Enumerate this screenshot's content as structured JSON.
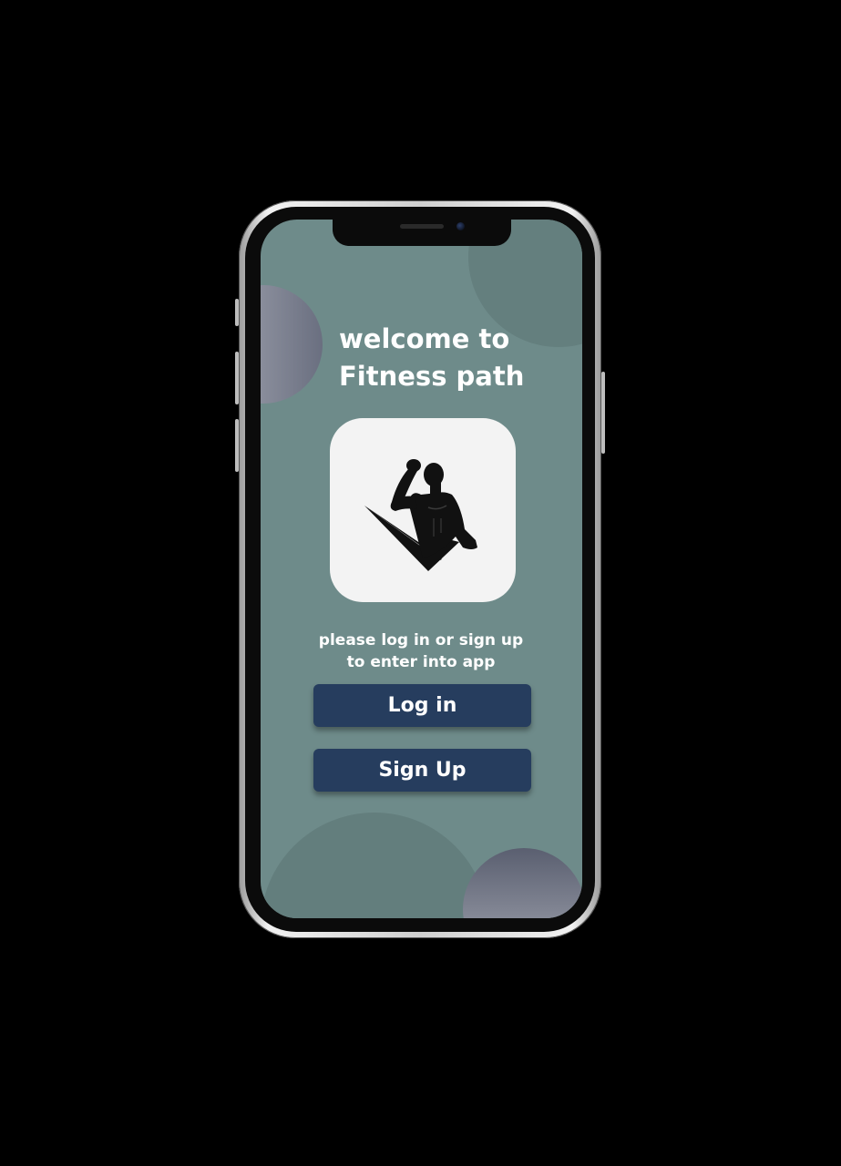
{
  "welcome": {
    "line1": "welcome to",
    "line2": "Fitness path"
  },
  "logo": {
    "icon": "bodybuilder-checkmark-icon"
  },
  "prompt": {
    "line1": "please log in or sign up",
    "line2": "to enter into app"
  },
  "buttons": {
    "login_label": "Log in",
    "signup_label": "Sign Up"
  },
  "colors": {
    "screen_background": "#6e8b8a",
    "button_background": "#263d5e",
    "card_background": "#f3f3f3",
    "text": "#ffffff"
  }
}
